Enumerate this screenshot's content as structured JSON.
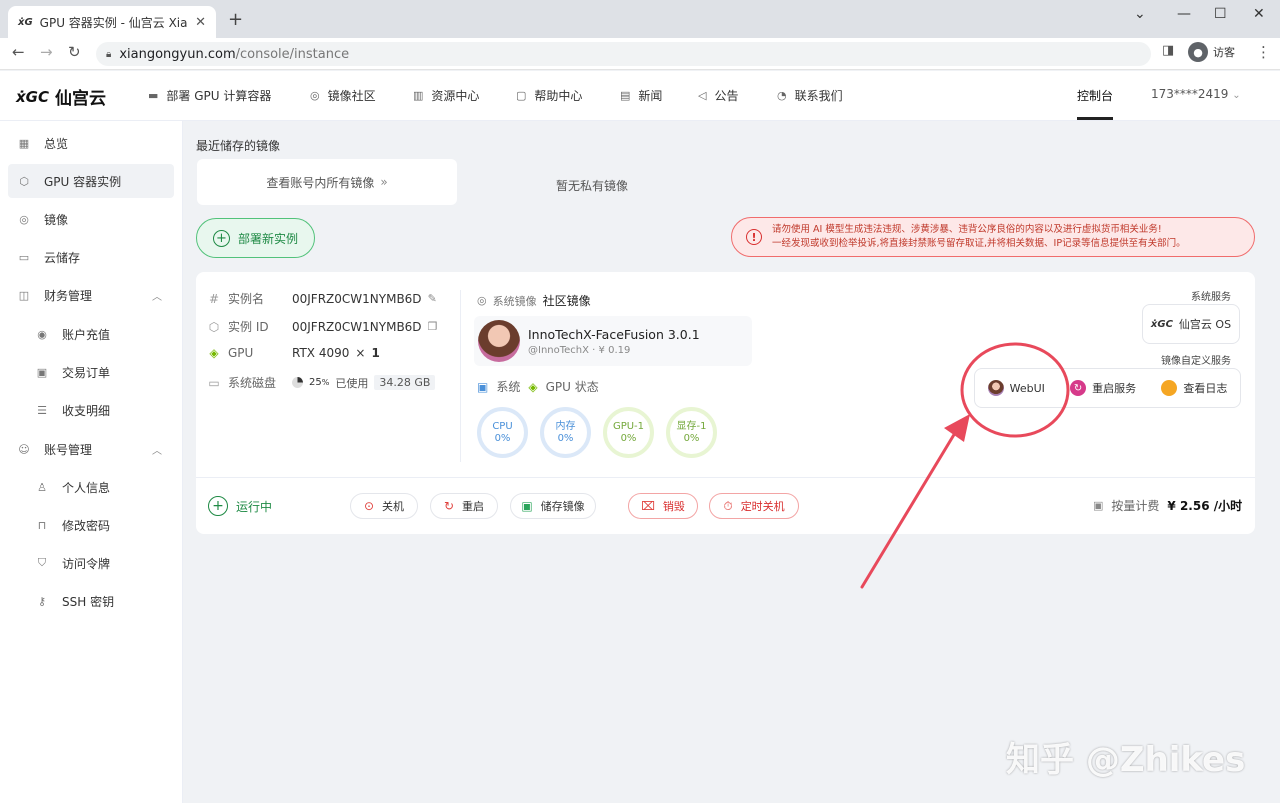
{
  "browser": {
    "tab_title": "GPU 容器实例 - 仙宫云 Xiangon",
    "url_host": "xiangongyun.com",
    "url_path": "/console/instance",
    "profile_label": "访客"
  },
  "topnav": {
    "logo_text": "仙宫云",
    "items": [
      "部署 GPU 计算容器",
      "镜像社区",
      "资源中心",
      "帮助中心",
      "新闻",
      "公告",
      "联系我们"
    ],
    "console": "控制台",
    "account": "173****2419"
  },
  "sidebar": {
    "items": [
      "总览",
      "GPU 容器实例",
      "镜像",
      "云储存",
      "财务管理",
      "账户充值",
      "交易订单",
      "收支明细",
      "账号管理",
      "个人信息",
      "修改密码",
      "访问令牌",
      "SSH 密钥"
    ]
  },
  "main": {
    "recent_label": "最近储存的镜像",
    "view_all": "查看账号内所有镜像",
    "no_private": "暂无私有镜像",
    "deploy_button": "部署新实例",
    "warning_line1": "请勿使用 AI 模型生成违法违规、涉黄涉暴、违背公序良俗的内容以及进行虚拟货币相关业务!",
    "warning_line2": "一经发现或收到检举投诉,将直接封禁账号留存取证,并将相关数据、IP记录等信息提供至有关部门。"
  },
  "instance": {
    "name_label": "实例名",
    "name": "00JFRZ0CW1NYMB6D",
    "id_label": "实例 ID",
    "id": "00JFRZ0CW1NYMB6D",
    "gpu_label": "GPU",
    "gpu": "RTX 4090",
    "gpu_mult": "×",
    "gpu_count": "1",
    "disk_label": "系统磁盘",
    "disk_percent": "25",
    "disk_pct_unit": "%",
    "disk_used_label": "已使用",
    "disk_used": "34.28 GB",
    "image_type_label": "系统镜像",
    "image_source": "社区镜像",
    "image_name": "InnoTechX-FaceFusion 3.0.1",
    "image_author": "@InnoTechX",
    "image_price": "¥ 0.19",
    "system_label": "系统",
    "gpu_status_label": "GPU 状态",
    "gauges": [
      {
        "label": "CPU",
        "value": "0%"
      },
      {
        "label": "内存",
        "value": "0%"
      },
      {
        "label": "GPU-1",
        "value": "0%"
      },
      {
        "label": "显存-1",
        "value": "0%"
      }
    ],
    "system_service_label": "系统服务",
    "os_button": "仙宫云 OS",
    "custom_service_label": "镜像自定义服务",
    "services": [
      "WebUI",
      "重启服务",
      "查看日志"
    ],
    "status": "运行中",
    "actions": [
      "关机",
      "重启",
      "储存镜像",
      "销毁",
      "定时关机"
    ],
    "billing_label": "按量计费",
    "price": "¥ 2.56",
    "price_unit": "/小时"
  },
  "watermark": "知乎 @Zhikes",
  "colors": {
    "accent_green": "#1f8a45",
    "danger_red": "#d93030",
    "annotation_red": "#e8495b"
  }
}
